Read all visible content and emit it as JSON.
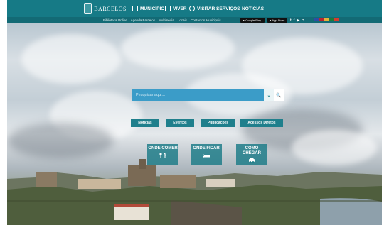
{
  "brand": {
    "name": "BARCELOS"
  },
  "nav": {
    "items": [
      {
        "label": "MUNICÍPIO",
        "icon": "building-icon"
      },
      {
        "label": "VIVER",
        "icon": "city-icon"
      },
      {
        "label": "VISITAR",
        "icon": "compass-icon"
      },
      {
        "label": "SERVIÇOS",
        "icon": ""
      },
      {
        "label": "NOTÍCIAS",
        "icon": ""
      }
    ]
  },
  "subnav": {
    "links": [
      "Biblioteca Online",
      "Agenda Barcelos",
      "Multimédia",
      "Locais",
      "Contactos Municipais"
    ],
    "google_play": "Google Play",
    "app_store": "App Store",
    "social": [
      "twitter-icon",
      "facebook-icon",
      "youtube-icon",
      "instagram-icon"
    ]
  },
  "search": {
    "placeholder": "Pesquisar aqui..."
  },
  "quick": {
    "noticias": "Notícias",
    "eventos": "Eventos",
    "publicacoes": "Publicações",
    "acessos": "Acessos Diretos"
  },
  "tiles": [
    {
      "label": "ONDE COMER",
      "icon": "cutlery-icon"
    },
    {
      "label": "ONDE FICAR",
      "icon": "bed-icon"
    },
    {
      "label": "COMO CHEGAR",
      "icon": "car-icon"
    }
  ],
  "colors": {
    "topbar": "#167a86",
    "search": "#3b9cc8",
    "tile": "#1a7a86"
  }
}
